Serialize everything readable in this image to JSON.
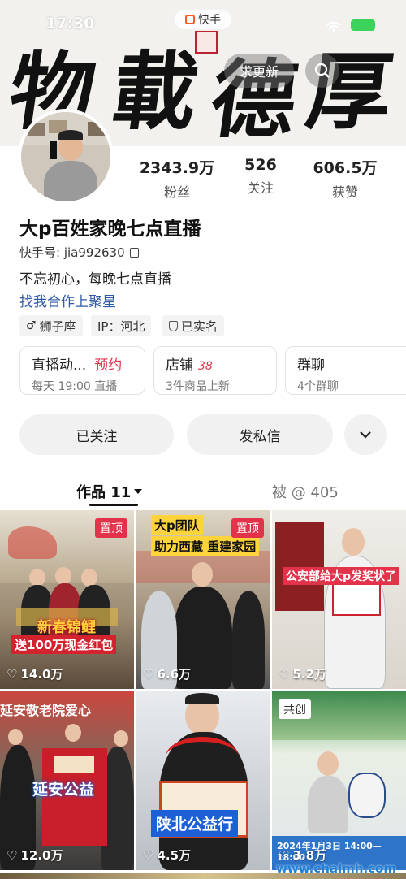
{
  "status_bar": {
    "time": "17:30",
    "app_name": "快手"
  },
  "header": {
    "calligraphy": [
      "物",
      "載",
      "德",
      "厚"
    ],
    "update_button": "求更新"
  },
  "profile": {
    "stats": [
      {
        "value": "2343.9万",
        "label": "粉丝"
      },
      {
        "value": "526",
        "label": "关注"
      },
      {
        "value": "606.5万",
        "label": "获赞"
      }
    ],
    "name": "大p百姓家晚七点直播",
    "account_id": "快手号: jia992630",
    "bio": "不忘初心，每晚七点直播",
    "link": "找我合作上聚星",
    "tags": [
      "狮子座",
      "IP：河北",
      "已实名"
    ]
  },
  "cards": [
    {
      "title": "直播动...",
      "action": "预约",
      "subtitle": "每天 19:00 直播"
    },
    {
      "title": "店铺",
      "badge": "38",
      "subtitle": "3件商品上新"
    },
    {
      "title": "群聊",
      "subtitle": "4个群聊"
    }
  ],
  "actions": {
    "followed": "已关注",
    "message": "发私信"
  },
  "tabs": {
    "works": "作品 11",
    "mentions": "被 @ 405"
  },
  "videos": [
    {
      "likes": "14.0万",
      "badge": "置顶",
      "caption1": "新春锦鲤",
      "caption2": "送100万现金红包"
    },
    {
      "likes": "6.6万",
      "badge": "置顶",
      "caption1": "大p团队",
      "caption2": "助力西藏 重建家园"
    },
    {
      "likes": "5.2万",
      "caption1": "公安部给大p发奖状了"
    },
    {
      "likes": "12.0万",
      "caption1": "延安敬老院爱心",
      "caption2": "延安公益"
    },
    {
      "likes": "4.5万",
      "caption1": "陕北公益行"
    },
    {
      "likes": "3.8万",
      "badge": "共创",
      "caption1": "2024年1月3日 14:00—18:00"
    }
  ],
  "watermark": "www.chalmh.com",
  "colors": {
    "accent": "#e3334b",
    "link": "#2f5aa8"
  }
}
